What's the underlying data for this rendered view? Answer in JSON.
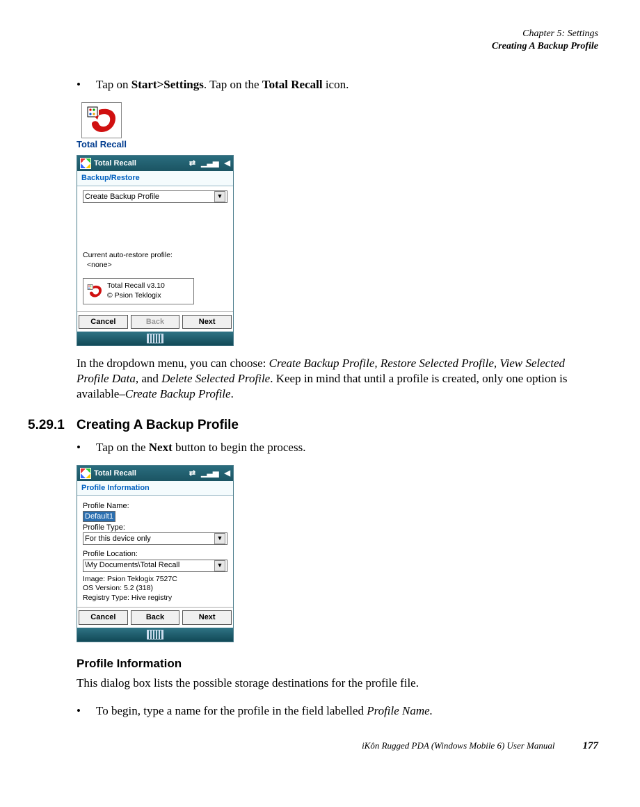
{
  "header": {
    "chapter": "Chapter 5:  Settings",
    "section": "Creating A Backup Profile"
  },
  "step1": {
    "pre": "Tap on ",
    "b1": "Start>Settings",
    "mid": ". Tap on the ",
    "b2": "Total Recall",
    "post": " icon."
  },
  "iconLabel": "Total Recall",
  "win1": {
    "title": "Total Recall",
    "tab": "Backup/Restore",
    "combo": "Create Backup Profile",
    "restoreLabel": "Current auto-restore profile:",
    "restoreValue": "<none>",
    "aboutLine1": "Total Recall v3.10",
    "aboutLine2": "© Psion Teklogix",
    "btnCancel": "Cancel",
    "btnBack": "Back",
    "btnNext": "Next"
  },
  "dropdownNote": {
    "pre": "In the dropdown menu, you can choose: ",
    "i1": "Create Backup Profile, Restore Selected Profile, View Selected Profile Data",
    "mid1": ", and ",
    "i2": "Delete Selected Profile",
    "mid2": ". Keep in mind that until a profile is created, only one option is available–",
    "i3": "Create Backup Profile",
    "post": "."
  },
  "sectionNum": "5.29.1",
  "sectionTitle": "Creating A Backup Profile",
  "step2": {
    "pre": "Tap on the ",
    "b1": "Next",
    "post": " button to begin the process."
  },
  "win2": {
    "title": "Total Recall",
    "tab": "Profile Information",
    "nameLabel": "Profile Name:",
    "nameValue": "Default1",
    "typeLabel": "Profile Type:",
    "typeValue": "For this device only",
    "locLabel": "Profile Location:",
    "locValue": "\\My Documents\\Total Recall",
    "info1": "Image: Psion Teklogix 7527C",
    "info2": "OS Version: 5.2 (318)",
    "info3": "Registry Type: Hive registry",
    "btnCancel": "Cancel",
    "btnBack": "Back",
    "btnNext": "Next"
  },
  "subheading": "Profile Information",
  "profileInfoText": "This dialog box lists the possible storage destinations for the profile file.",
  "step3": {
    "pre": "To begin, type a name for the profile in the field labelled ",
    "i1": "Profile Name.",
    "post": ""
  },
  "footer": {
    "manual": "iKôn Rugged PDA (Windows Mobile 6) User Manual",
    "page": "177"
  }
}
